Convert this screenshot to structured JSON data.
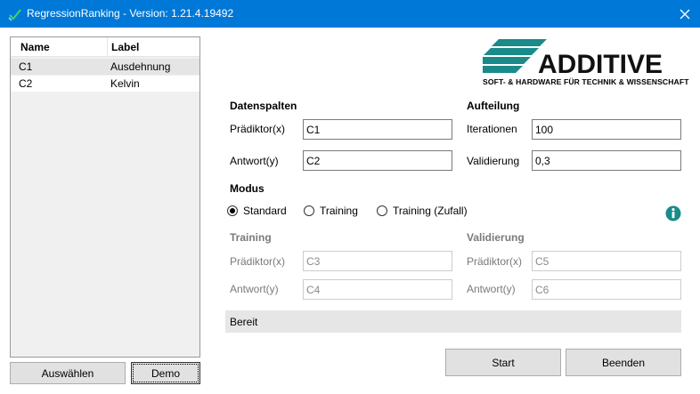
{
  "window": {
    "title": "RegressionRanking - Version: 1.21.4.19492",
    "colors": {
      "titlebar": "#0078d7",
      "accent_teal": "#1a8a8a"
    }
  },
  "list": {
    "columns": [
      "Name",
      "Label"
    ],
    "rows": [
      {
        "name": "C1",
        "label": "Ausdehnung"
      },
      {
        "name": "C2",
        "label": "Kelvin"
      }
    ]
  },
  "buttons": {
    "select": "Auswählen",
    "demo": "Demo",
    "start": "Start",
    "quit": "Beenden"
  },
  "logo": {
    "wordmark": "ADDITIVE",
    "subtitle": "SOFT- & HARDWARE FÜR TECHNIK & WISSENSCHAFT"
  },
  "data_columns": {
    "heading": "Datenspalten",
    "predictor_label": "Prädiktor(x)",
    "predictor_value": "C1",
    "response_label": "Antwort(y)",
    "response_value": "C2"
  },
  "split": {
    "heading": "Aufteilung",
    "iterations_label": "Iterationen",
    "iterations_value": "100",
    "validation_label": "Validierung",
    "validation_value": "0,3"
  },
  "mode": {
    "heading": "Modus",
    "options": [
      "Standard",
      "Training",
      "Training (Zufall)"
    ],
    "selected": "Standard"
  },
  "training": {
    "heading": "Training",
    "predictor_label": "Prädiktor(x)",
    "predictor_value": "C3",
    "response_label": "Antwort(y)",
    "response_value": "C4"
  },
  "validation": {
    "heading": "Validierung",
    "predictor_label": "Prädiktor(x)",
    "predictor_value": "C5",
    "response_label": "Antwort(y)",
    "response_value": "C6"
  },
  "status": "Bereit",
  "icons": {
    "app": "app-check-icon",
    "close": "close-icon",
    "info": "info-icon"
  }
}
